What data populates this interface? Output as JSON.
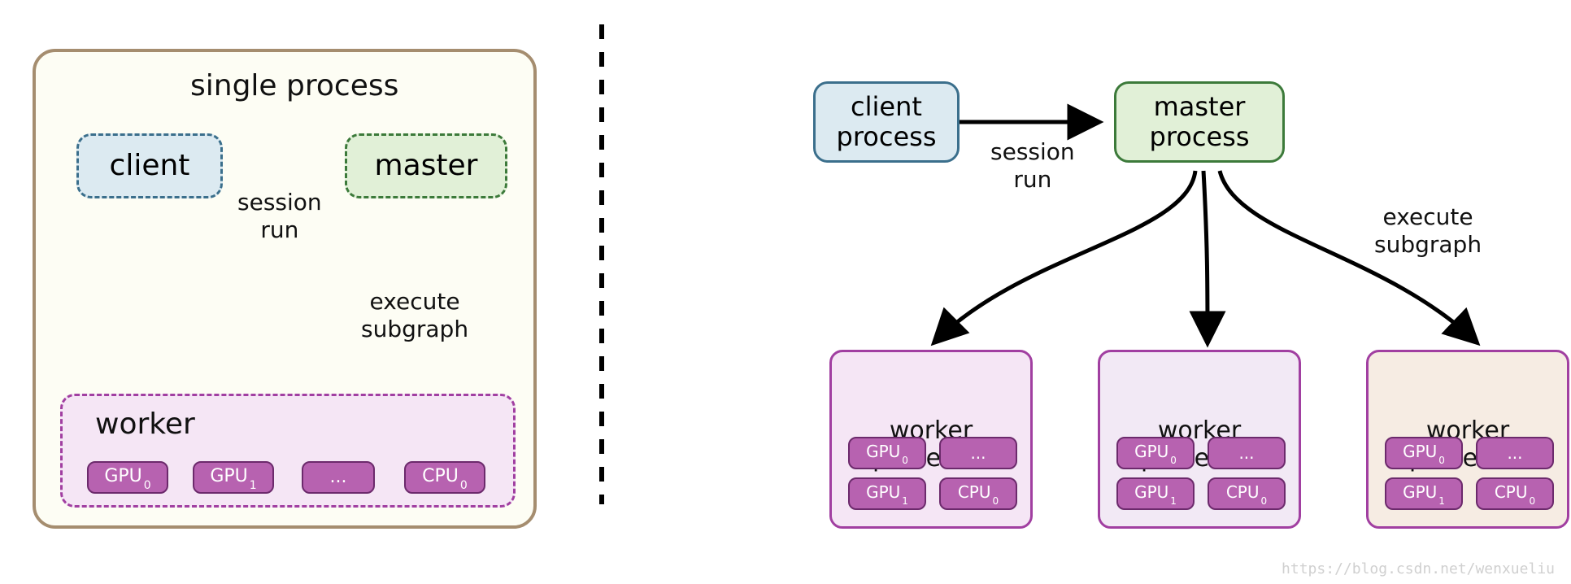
{
  "left": {
    "container_title": "single process",
    "client": "client",
    "master": "master",
    "session_run": "session\nrun",
    "execute_subgraph": "execute\nsubgraph",
    "worker_title": "worker",
    "devices": [
      "GPU0",
      "GPU1",
      "...",
      "CPU0"
    ]
  },
  "right": {
    "client_process": "client\nprocess",
    "master_process": "master\nprocess",
    "session_run": "session\nrun",
    "execute_subgraph": "execute\nsubgraph",
    "workers": [
      {
        "title": "worker\nprocess 1",
        "devices": [
          "GPU0",
          "...",
          "GPU1",
          "CPU0"
        ]
      },
      {
        "title": "worker\nprocess 2",
        "devices": [
          "GPU0",
          "...",
          "GPU1",
          "CPU0"
        ]
      },
      {
        "title": "worker\nprocess 3",
        "devices": [
          "GPU0",
          "...",
          "GPU1",
          "CPU0"
        ]
      }
    ]
  },
  "watermark": "https://blog.csdn.net/wenxueliu"
}
